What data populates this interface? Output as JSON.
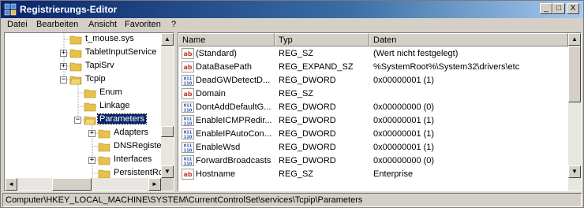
{
  "window": {
    "title": "Registrierungs-Editor"
  },
  "titlebar_buttons": {
    "minimize": "_",
    "maximize": "□",
    "close": "X"
  },
  "menu": [
    "Datei",
    "Bearbeiten",
    "Ansicht",
    "Favoriten",
    "?"
  ],
  "tree": {
    "items": [
      {
        "label": "t_mouse.sys",
        "expander": "",
        "selected": false
      },
      {
        "label": "TabletInputService",
        "expander": "+",
        "selected": false
      },
      {
        "label": "TapiSrv",
        "expander": "+",
        "selected": false
      },
      {
        "label": "Tcpip",
        "expander": "−",
        "selected": false
      },
      {
        "label": "Enum",
        "expander": "",
        "selected": false
      },
      {
        "label": "Linkage",
        "expander": "",
        "selected": false
      },
      {
        "label": "Parameters",
        "expander": "−",
        "selected": true
      },
      {
        "label": "Adapters",
        "expander": "+",
        "selected": false
      },
      {
        "label": "DNSRegistered",
        "expander": "",
        "selected": false
      },
      {
        "label": "Interfaces",
        "expander": "+",
        "selected": false
      },
      {
        "label": "PersistentRoutes",
        "expander": "",
        "selected": false
      }
    ]
  },
  "list": {
    "columns": [
      "Name",
      "Typ",
      "Daten"
    ],
    "rows": [
      {
        "icon": "string-value-icon",
        "name": "(Standard)",
        "type": "REG_SZ",
        "data": "(Wert nicht festgelegt)"
      },
      {
        "icon": "string-value-icon",
        "name": "DataBasePath",
        "type": "REG_EXPAND_SZ",
        "data": "%SystemRoot%\\System32\\drivers\\etc"
      },
      {
        "icon": "binary-value-icon",
        "name": "DeadGWDetectD...",
        "type": "REG_DWORD",
        "data": "0x00000001 (1)"
      },
      {
        "icon": "string-value-icon",
        "name": "Domain",
        "type": "REG_SZ",
        "data": ""
      },
      {
        "icon": "binary-value-icon",
        "name": "DontAddDefaultG...",
        "type": "REG_DWORD",
        "data": "0x00000000 (0)"
      },
      {
        "icon": "binary-value-icon",
        "name": "EnableICMPRedir...",
        "type": "REG_DWORD",
        "data": "0x00000001 (1)"
      },
      {
        "icon": "binary-value-icon",
        "name": "EnableIPAutoCon...",
        "type": "REG_DWORD",
        "data": "0x00000001 (1)"
      },
      {
        "icon": "binary-value-icon",
        "name": "EnableWsd",
        "type": "REG_DWORD",
        "data": "0x00000001 (1)"
      },
      {
        "icon": "binary-value-icon",
        "name": "ForwardBroadcasts",
        "type": "REG_DWORD",
        "data": "0x00000000 (0)"
      },
      {
        "icon": "string-value-icon",
        "name": "Hostname",
        "type": "REG_SZ",
        "data": "Enterprise"
      }
    ]
  },
  "status": {
    "path": "Computer\\HKEY_LOCAL_MACHINE\\SYSTEM\\CurrentControlSet\\services\\Tcpip\\Parameters"
  },
  "scroll_icons": {
    "up": "▲",
    "down": "▼",
    "left": "◄",
    "right": "►"
  },
  "colors": {
    "title_start": "#0a246a",
    "title_end": "#a6caf0",
    "selection": "#0a246a",
    "folder": "#e8c14a",
    "string_icon": "#c0392b",
    "binary_icon": "#1f4fa8"
  }
}
